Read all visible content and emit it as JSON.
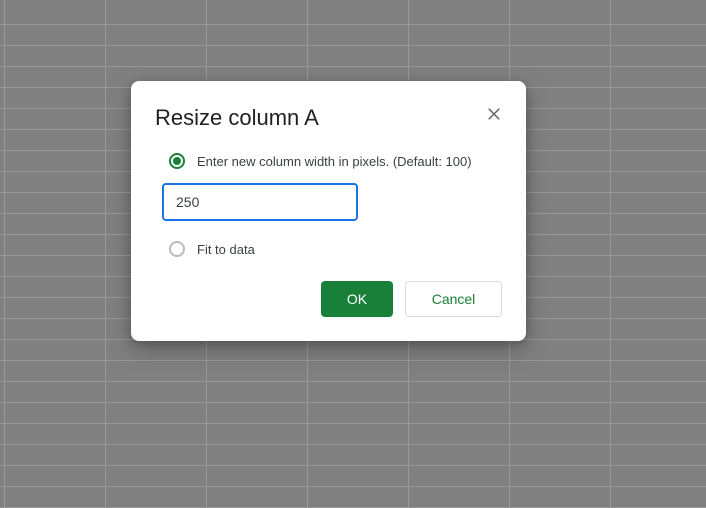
{
  "dialog": {
    "title": "Resize column A",
    "option1_label": "Enter new column width in pixels. (Default: 100)",
    "input_value": "250",
    "option2_label": "Fit to data",
    "ok_label": "OK",
    "cancel_label": "Cancel"
  }
}
